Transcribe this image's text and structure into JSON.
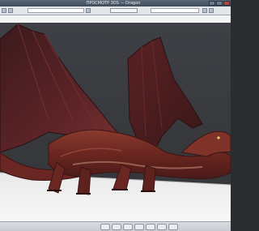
{
  "window": {
    "title": "ПРОСМОТР  3DS — Dragon"
  },
  "toolbar": {
    "search_value": "",
    "button_label": "",
    "colors": {
      "bar": "#e4e7ea",
      "field": "#ffffff"
    }
  },
  "pathbar": {
    "path": ""
  },
  "viewport": {
    "background": "#3a3c40",
    "floor": "#f2f2f2",
    "model": "dragon",
    "model_colors": {
      "body": "#7a2a22",
      "wing": "#5a2226",
      "belly": "#a86a5a"
    }
  },
  "taskbar": {
    "icons": [
      "folder-icon",
      "app-icon",
      "app-icon",
      "app-icon",
      "app-icon",
      "app-icon",
      "app-icon"
    ]
  }
}
